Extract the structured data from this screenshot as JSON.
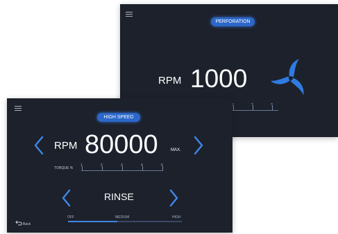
{
  "back_screen": {
    "mode_badge": "PERFORATION",
    "rpm_label": "RPM",
    "rpm_value": "1000",
    "scale_labels": [
      "?",
      "?",
      "?"
    ]
  },
  "front_screen": {
    "mode_badge": "HIGH SPEED",
    "rpm_label": "RPM",
    "rpm_value": "80000",
    "max_label": "MAX.",
    "torque_label": "TORQUE %",
    "torque_ticks": [
      "1",
      "2",
      "3",
      "4",
      "5"
    ],
    "mode_name": "RINSE",
    "flow_labels": [
      "OFF",
      "MEDIUM",
      "HIGH"
    ],
    "flow_level": 0.43,
    "back_label": "Back"
  },
  "colors": {
    "panel": "#1d212c",
    "accent": "#3f86e6",
    "badge": "#2c67c9"
  }
}
